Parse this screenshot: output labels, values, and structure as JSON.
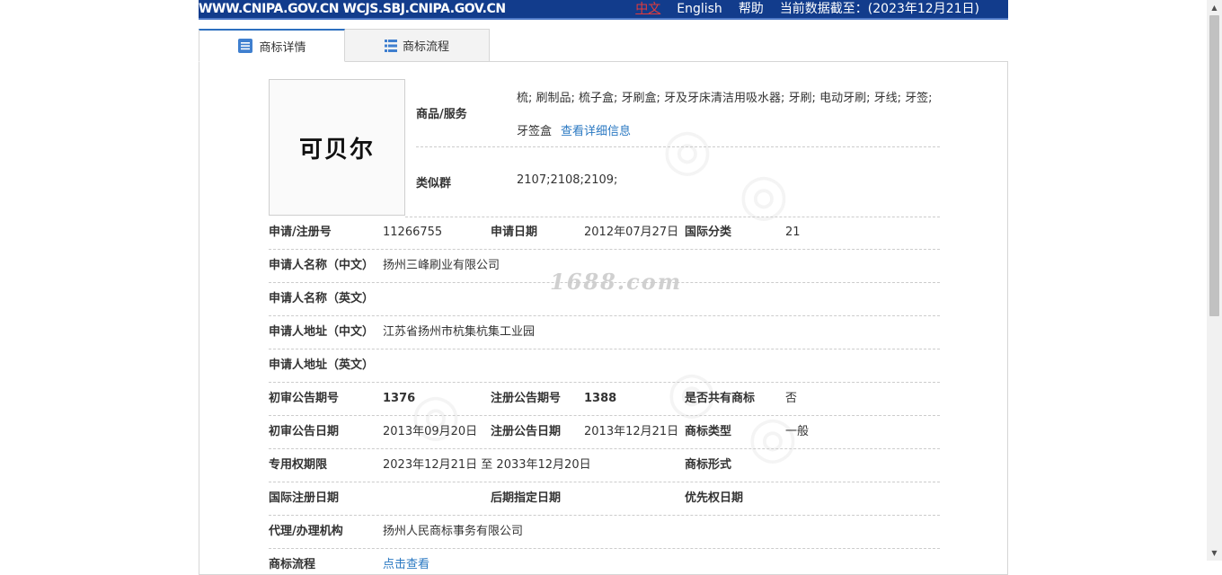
{
  "topbar": {
    "site": "WWW.CNIPA.GOV.CN WCJS.SBJ.CNIPA.GOV.CN",
    "lang_cn": "中文",
    "lang_en": "English",
    "help": "帮助",
    "data_date": "当前数据截至：(2023年12月21日)"
  },
  "tabs": [
    {
      "label": "商标详情",
      "icon": "document-list-icon",
      "active": true
    },
    {
      "label": "商标流程",
      "icon": "grid-list-icon",
      "active": false
    }
  ],
  "trademark": {
    "image_text": "可贝尔",
    "goods_label": "商品/服务",
    "goods_text": "梳; 刷制品; 梳子盒; 牙刷盒; 牙及牙床清洁用吸水器; 牙刷; 电动牙刷; 牙线; 牙签; 牙签盒",
    "goods_link": "查看详细信息",
    "similar_label": "类似群",
    "similar_value": "2107;2108;2109;"
  },
  "watermark": "1688.com",
  "rows": {
    "r1": {
      "l1": "申请/注册号",
      "v1": "11266755",
      "l2": "申请日期",
      "v2": "2012年07月27日",
      "l3": "国际分类",
      "v3": "21"
    },
    "r2": {
      "l1": "申请人名称（中文）",
      "v1": "扬州三峰刷业有限公司"
    },
    "r3": {
      "l1": "申请人名称（英文）",
      "v1": ""
    },
    "r4": {
      "l1": "申请人地址（中文）",
      "v1": "江苏省扬州市杭集杭集工业园"
    },
    "r5": {
      "l1": "申请人地址（英文）",
      "v1": ""
    },
    "r6": {
      "l1": "初审公告期号",
      "v1": "1376",
      "l2": "注册公告期号",
      "v2": "1388",
      "l3": "是否共有商标",
      "v3": "否"
    },
    "r7": {
      "l1": "初审公告日期",
      "v1": "2013年09月20日",
      "l2": "注册公告日期",
      "v2": "2013年12月21日",
      "l3": "商标类型",
      "v3": "一般"
    },
    "r8": {
      "l1": "专用权期限",
      "v1": "2023年12月21日 至 2033年12月20日",
      "l3": "商标形式",
      "v3": ""
    },
    "r9": {
      "l1": "国际注册日期",
      "v1": "",
      "l2": "后期指定日期",
      "v2": "",
      "l3": "优先权日期",
      "v3": ""
    },
    "r10": {
      "l1": "代理/办理机构",
      "v1": "扬州人民商标事务有限公司"
    },
    "r11": {
      "l1": "商标流程",
      "v1": "点击查看"
    }
  },
  "colors": {
    "banner": "#123c8c",
    "link": "#2a78c2",
    "active_tab_border": "#2d6fbf",
    "lang_active": "#e23b3b"
  }
}
